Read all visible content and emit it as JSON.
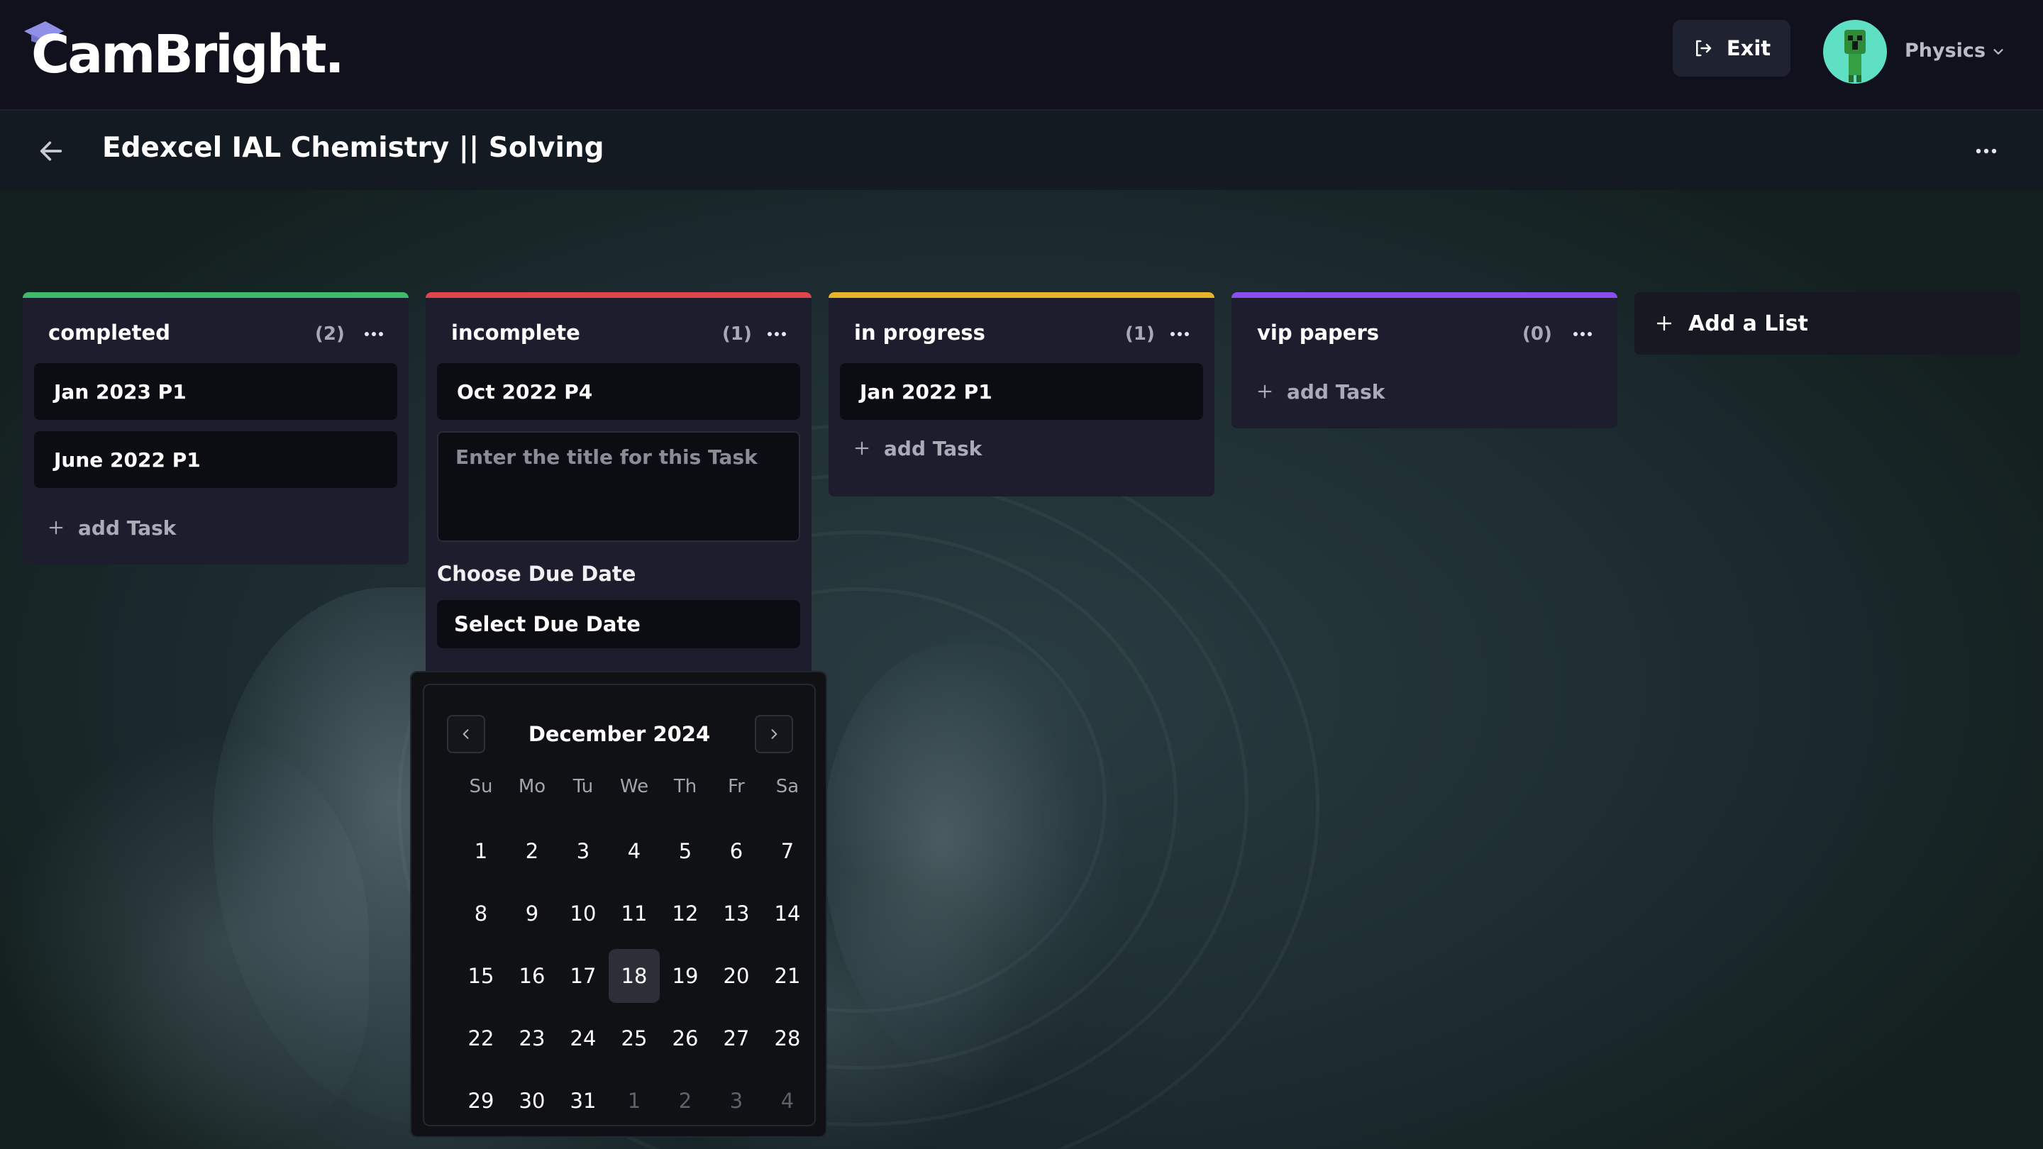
{
  "header": {
    "logo_text": "CamBright.",
    "exit_label": "Exit",
    "subject_label": "Physics"
  },
  "board": {
    "title": "Edexcel IAL Chemistry || Solving"
  },
  "lists": [
    {
      "title": "completed",
      "count": "(2)",
      "color": "#3fba6a",
      "cards": [
        "Jan 2023 P1",
        "June 2022 P1"
      ],
      "add_task_label": "add Task"
    },
    {
      "title": "incomplete",
      "count": "(1)",
      "color": "#e0454b",
      "cards": [
        "Oct 2022 P4"
      ],
      "task_placeholder": "Enter the title for this Task",
      "due_label": "Choose Due Date",
      "due_button": "Select Due Date"
    },
    {
      "title": "in progress",
      "count": "(1)",
      "color": "#e7b42a",
      "cards": [
        "Jan 2022 P1"
      ],
      "add_task_label": "add Task"
    },
    {
      "title": "vip papers",
      "count": "(0)",
      "color": "#8a4df0",
      "cards": [],
      "add_task_label": "add Task"
    }
  ],
  "add_list_label": "Add a List",
  "calendar": {
    "month_label": "December 2024",
    "weekdays": [
      "Su",
      "Mo",
      "Tu",
      "We",
      "Th",
      "Fr",
      "Sa"
    ],
    "days": [
      "1",
      "2",
      "3",
      "4",
      "5",
      "6",
      "7",
      "8",
      "9",
      "10",
      "11",
      "12",
      "13",
      "14",
      "15",
      "16",
      "17",
      "18",
      "19",
      "20",
      "21",
      "22",
      "23",
      "24",
      "25",
      "26",
      "27",
      "28",
      "29",
      "30",
      "31",
      "1",
      "2",
      "3",
      "4"
    ],
    "outside_month": [
      31,
      32,
      33,
      34
    ],
    "selected_day": "18"
  }
}
